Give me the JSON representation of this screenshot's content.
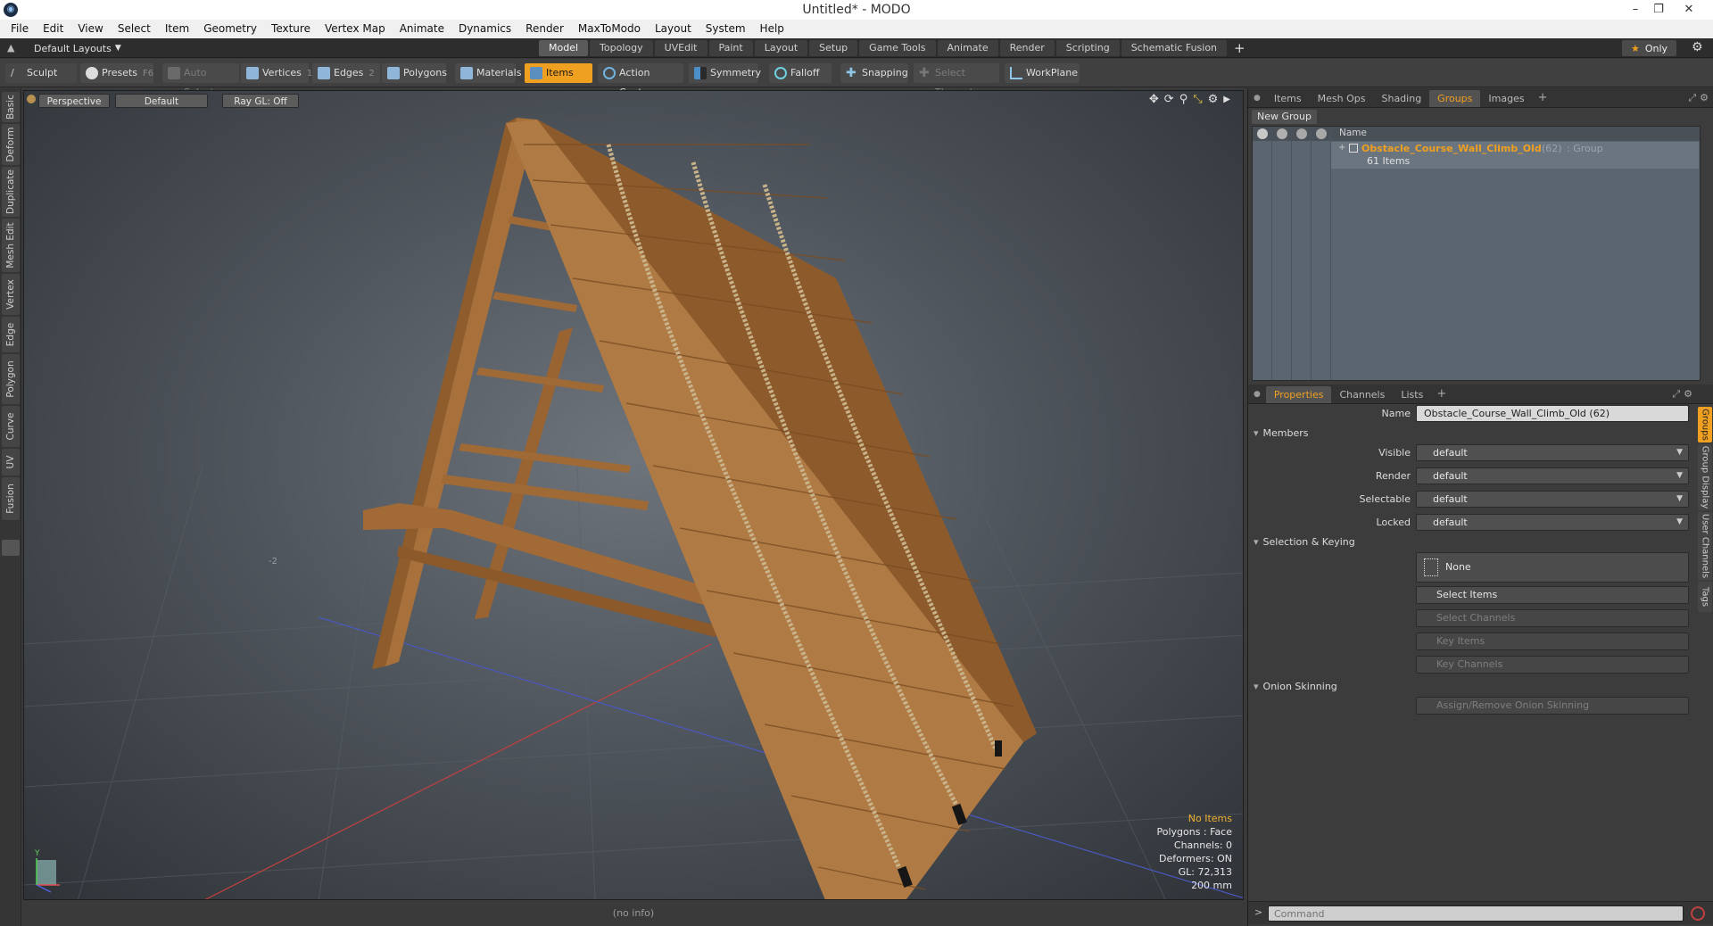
{
  "window": {
    "title": "Untitled* - MODO",
    "logo": "modo-logo"
  },
  "menu": [
    "File",
    "Edit",
    "View",
    "Select",
    "Item",
    "Geometry",
    "Texture",
    "Vertex Map",
    "Animate",
    "Dynamics",
    "Render",
    "MaxToModo",
    "Layout",
    "System",
    "Help"
  ],
  "layoutbar": {
    "layout_name": "Default Layouts",
    "tabs": [
      "Model",
      "Topology",
      "UVEdit",
      "Paint",
      "Layout",
      "Setup",
      "Game Tools",
      "Animate",
      "Render",
      "Scripting",
      "Schematic Fusion"
    ],
    "active_tab": "Model",
    "only_label": "Only"
  },
  "toolbar": {
    "sculpt": "Sculpt",
    "presets": "Presets",
    "presets_key": "F6",
    "auto_select": "Auto Select",
    "vertices": "Vertices",
    "vertices_key": "1",
    "edges": "Edges",
    "edges_key": "2",
    "polygons": "Polygons",
    "materials": "Materials",
    "items": "Items",
    "action_center": "Action Center",
    "symmetry": "Symmetry",
    "falloff": "Falloff",
    "snapping": "Snapping",
    "select_through": "Select Through",
    "workplane": "WorkPlane"
  },
  "left_tabs": [
    "Basic",
    "Deform",
    "Duplicate",
    "Mesh Edit",
    "Vertex",
    "Edge",
    "Polygon",
    "Curve",
    "UV",
    "Fusion"
  ],
  "viewport": {
    "view": "Perspective",
    "style": "Default",
    "raygl": "Ray GL: Off",
    "axis_label": "-2",
    "info": {
      "selection": "No Items",
      "polygons": "Polygons : Face",
      "channels": "Channels: 0",
      "deformers": "Deformers: ON",
      "gl": "GL: 72,313",
      "scale": "200 mm"
    },
    "status": "(no info)",
    "axis_y": "Y"
  },
  "groups_panel": {
    "tabs": [
      "Items",
      "Mesh Ops",
      "Shading",
      "Groups",
      "Images"
    ],
    "active_tab": "Groups",
    "new_group": "New Group",
    "col_name": "Name",
    "group": {
      "name": "Obstacle_Course_Wall_Climb_Old",
      "count": "(62)",
      "type": ": Group",
      "items": "61 Items"
    }
  },
  "properties_panel": {
    "tabs": [
      "Properties",
      "Channels",
      "Lists"
    ],
    "active_tab": "Properties",
    "name_label": "Name",
    "name_value": "Obstacle_Course_Wall_Climb_Old (62)",
    "members": "Members",
    "visible_label": "Visible",
    "visible_value": "default",
    "render_label": "Render",
    "render_value": "default",
    "selectable_label": "Selectable",
    "selectable_value": "default",
    "locked_label": "Locked",
    "locked_value": "default",
    "selection_keying": "Selection & Keying",
    "none_label": "None",
    "select_items": "Select Items",
    "select_channels": "Select Channels",
    "key_items": "Key Items",
    "key_channels": "Key Channels",
    "onion_skinning": "Onion Skinning",
    "assign_onion": "Assign/Remove Onion Skinning",
    "side_tabs": [
      "Groups",
      "Group Display",
      "User Channels",
      "Tags"
    ]
  },
  "command": {
    "placeholder": "Command"
  },
  "colors": {
    "accent": "#f0a020",
    "group_name": "#f0a020"
  }
}
